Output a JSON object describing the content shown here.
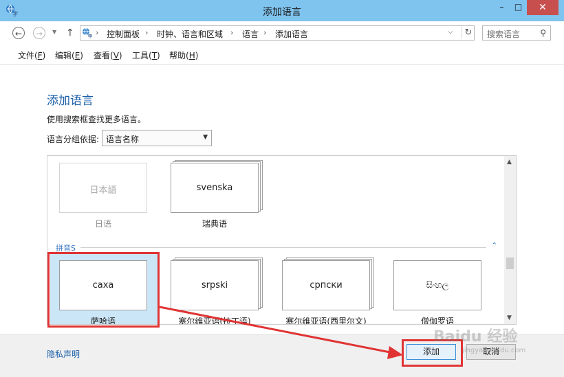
{
  "window": {
    "title": "添加语言",
    "minimize_glyph": "–",
    "maximize_glyph": "□",
    "close_glyph": "✕"
  },
  "nav": {
    "back_glyph": "←",
    "forward_glyph": "→",
    "recent_glyph": "▼",
    "up_glyph": "↑",
    "breadcrumbs": [
      "控制面板",
      "时钟、语言和区域",
      "语言",
      "添加语言"
    ],
    "separator": "›",
    "dropdown_glyph": "⌵",
    "refresh_glyph": "↻",
    "search_placeholder": "搜索语言",
    "search_glyph": "⚲"
  },
  "menu": [
    {
      "label": "文件(",
      "key": "F",
      "end": ")"
    },
    {
      "label": "编辑(",
      "key": "E",
      "end": ")"
    },
    {
      "label": "查看(",
      "key": "V",
      "end": ")"
    },
    {
      "label": "工具(",
      "key": "T",
      "end": ")"
    },
    {
      "label": "帮助(",
      "key": "H",
      "end": ")"
    }
  ],
  "content": {
    "title": "添加语言",
    "hint": "使用搜索框查找更多语言。",
    "group_label": "语言分组依据:",
    "group_value": "语言名称",
    "section_label": "拼音S",
    "section_collapse_glyph": "⌃",
    "top_tiles": [
      {
        "native": "日本語",
        "name": "日语",
        "faded": true
      },
      {
        "native": "svenska",
        "name": "瑞典语",
        "faded": false
      }
    ],
    "s_tiles": [
      {
        "native": "саха",
        "name": "萨哈语",
        "selected": true
      },
      {
        "native": "srpski",
        "name": "塞尔维亚语(拉丁语)",
        "selected": false
      },
      {
        "native": "српски",
        "name": "塞尔维亚语(西里尔文)",
        "selected": false
      },
      {
        "native": "සිංහල",
        "name": "僧伽罗语",
        "selected": false
      }
    ],
    "scroll_up_glyph": "▲",
    "scroll_down_glyph": "▼"
  },
  "footer": {
    "privacy": "隐私声明",
    "add": "添加",
    "cancel": "取消"
  },
  "watermark": {
    "main": "Baidu 经验",
    "sub": "jingyan.baidu.com"
  },
  "colors": {
    "titlebar": "#7fc3ef",
    "accent_link": "#1a5fa8",
    "highlight": "#e03434",
    "selection": "#cbe6f7"
  }
}
